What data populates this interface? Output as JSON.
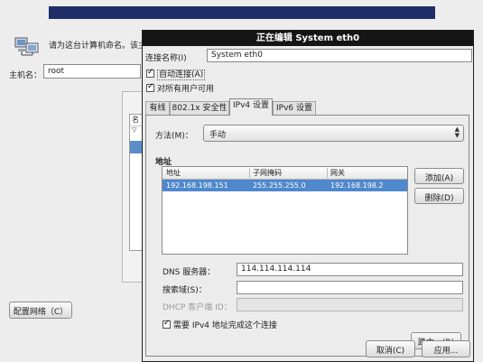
{
  "host": {
    "prompt": "请为这台计算机命名。该主",
    "label": "主机名：",
    "value": "root",
    "list_header": "名",
    "list_arrow": "▽",
    "configure_network_button": "配置网络（C）"
  },
  "dialog": {
    "title": "正在编辑 System eth0",
    "connection_name_label": "连接名称(I)",
    "connection_name_value": "System eth0",
    "auto_connect_label": "自动连接(A)",
    "auto_connect_checked": true,
    "all_users_label": "对所有用户可用",
    "all_users_checked": true,
    "tabs": [
      {
        "label": "有线"
      },
      {
        "label": "802.1x 安全性"
      },
      {
        "label": "IPv4 设置"
      },
      {
        "label": "IPv6 设置"
      }
    ],
    "ipv4": {
      "method_label": "方法(M)：",
      "method_value": "手动",
      "address_section": "地址",
      "columns": [
        "地址",
        "子网掩码",
        "网关"
      ],
      "rows": [
        {
          "address": "192.168.198.151",
          "netmask": "255.255.255.0",
          "gateway": "192.168.198.2"
        }
      ],
      "add_button": "添加(A)",
      "delete_button": "删除(D)",
      "dns_label": "DNS 服务器：",
      "dns_value": "114.114.114.114",
      "search_label": "搜索域(S)：",
      "search_value": "",
      "dhcp_label": "DHCP 客户端 ID：",
      "dhcp_value": "",
      "require_ipv4_label": "需要 IPv4 地址完成这个连接",
      "require_ipv4_checked": true,
      "routes_button": "路由…(R)"
    },
    "cancel_button": "取消(C)",
    "apply_button": "应用..."
  }
}
